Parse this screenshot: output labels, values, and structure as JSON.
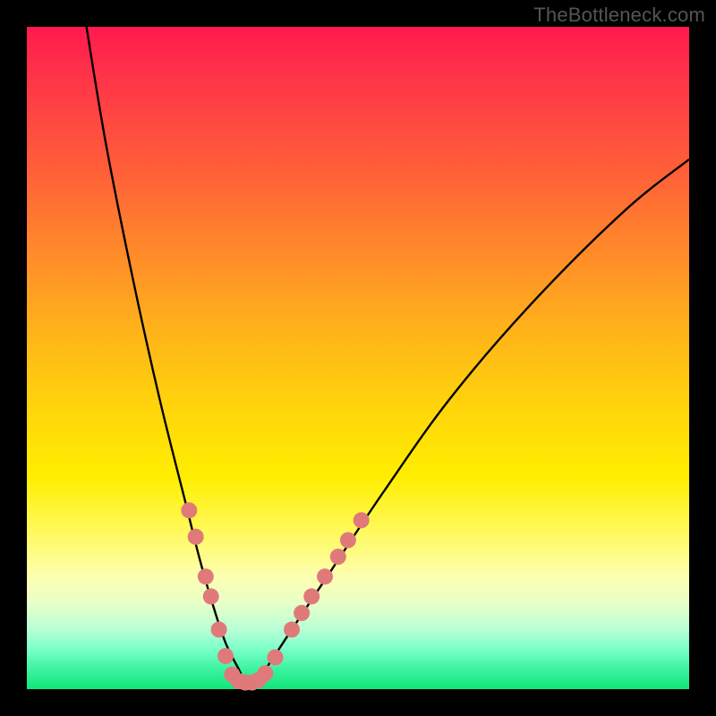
{
  "watermark": "TheBottleneck.com",
  "chart_data": {
    "type": "line",
    "title": "",
    "xlabel": "",
    "ylabel": "",
    "xlim": [
      0,
      100
    ],
    "ylim": [
      0,
      100
    ],
    "series": [
      {
        "name": "bottleneck-curve",
        "x": [
          9,
          12,
          16,
          20,
          24,
          26,
          28,
          30,
          32,
          33,
          34,
          36,
          40,
          46,
          54,
          64,
          76,
          90,
          100
        ],
        "y": [
          100,
          82,
          62,
          44,
          28,
          20,
          13,
          7,
          3,
          1,
          1,
          3,
          9,
          18,
          30,
          44,
          58,
          72,
          80
        ]
      }
    ],
    "markers": {
      "name": "highlight-dots",
      "color": "#e07a7a",
      "radius_px": 9,
      "points": [
        {
          "x": 24.5,
          "y": 27
        },
        {
          "x": 25.5,
          "y": 23
        },
        {
          "x": 27.0,
          "y": 17
        },
        {
          "x": 27.8,
          "y": 14
        },
        {
          "x": 29.0,
          "y": 9
        },
        {
          "x": 30.0,
          "y": 5
        },
        {
          "x": 31.0,
          "y": 2.2
        },
        {
          "x": 32.0,
          "y": 1.2
        },
        {
          "x": 33.0,
          "y": 1.0
        },
        {
          "x": 34.0,
          "y": 1.0
        },
        {
          "x": 35.0,
          "y": 1.4
        },
        {
          "x": 36.0,
          "y": 2.4
        },
        {
          "x": 37.5,
          "y": 4.8
        },
        {
          "x": 40.0,
          "y": 9
        },
        {
          "x": 41.5,
          "y": 11.5
        },
        {
          "x": 43.0,
          "y": 14
        },
        {
          "x": 45.0,
          "y": 17
        },
        {
          "x": 47.0,
          "y": 20
        },
        {
          "x": 48.5,
          "y": 22.5
        },
        {
          "x": 50.5,
          "y": 25.5
        }
      ]
    }
  }
}
